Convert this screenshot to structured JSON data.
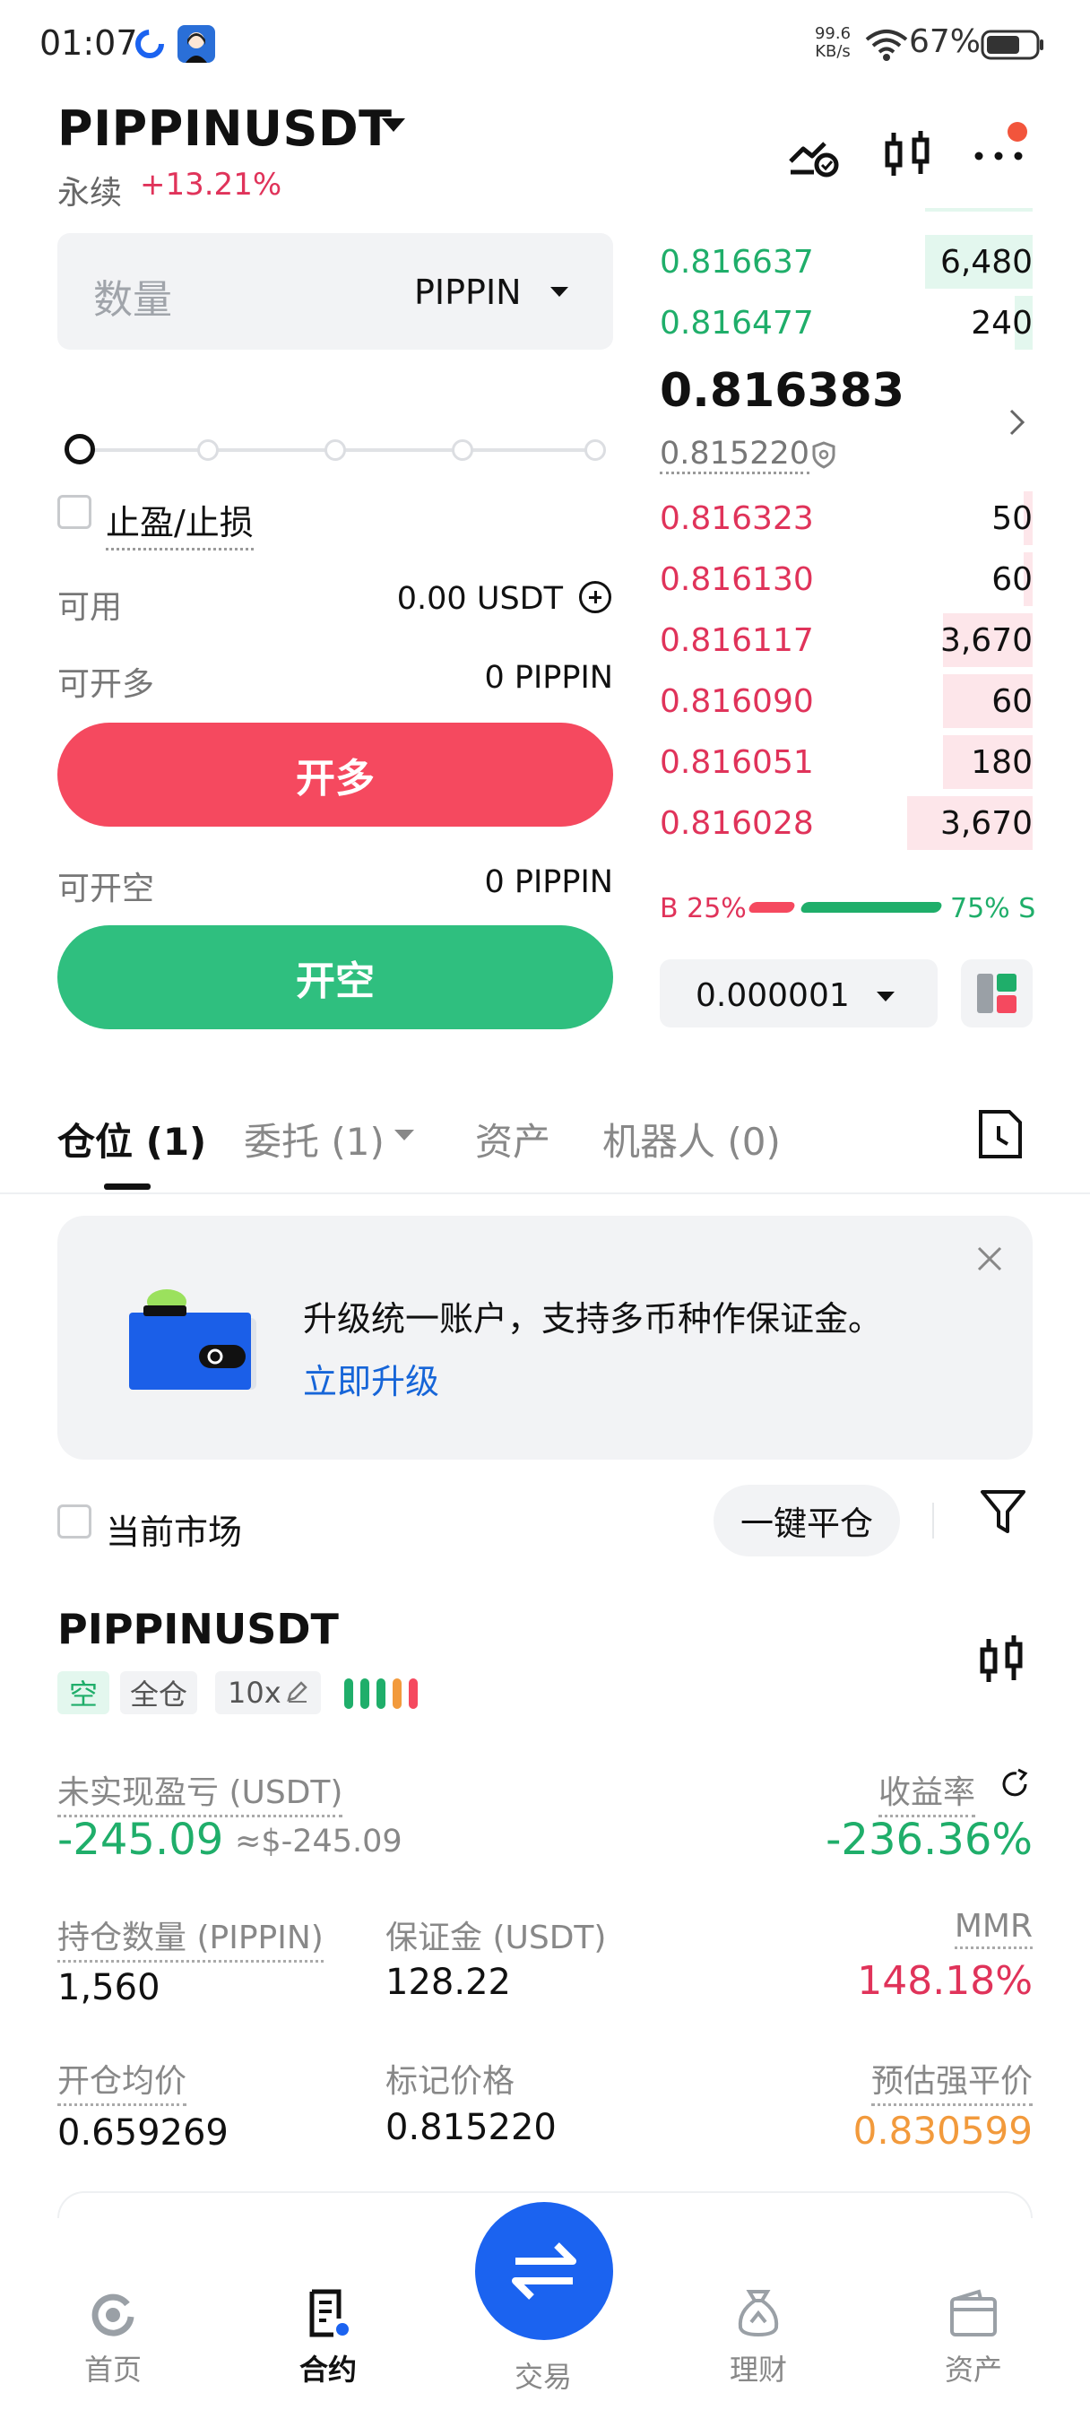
{
  "status_bar": {
    "time": "01:07",
    "net_speed_value": "99.6",
    "net_speed_unit": "KB/s",
    "battery": "67%"
  },
  "header": {
    "pair": "PIPPINUSDT",
    "contract_type": "永续",
    "change_pct": "+13.21%",
    "icons": [
      "trend-check-icon",
      "candlestick-icon",
      "more-icon"
    ]
  },
  "order_form": {
    "qty_placeholder": "数量",
    "qty_unit": "PIPPIN",
    "tpsl_label": "止盈/止损",
    "available_label": "可用",
    "available_value": "0.00 USDT",
    "can_long_label": "可开多",
    "can_long_value": "0 PIPPIN",
    "long_button": "开多",
    "can_short_label": "可开空",
    "can_short_value": "0 PIPPIN",
    "short_button": "开空",
    "leverage_slider_pct": 0
  },
  "order_book": {
    "asks": [
      {
        "price": "0.816637",
        "qty": "6,480",
        "depth": 0.17
      },
      {
        "price": "0.816477",
        "qty": "240",
        "depth": 0.03
      }
    ],
    "last_price": "0.816383",
    "mark_price": "0.815220",
    "bids": [
      {
        "price": "0.816323",
        "qty": "50",
        "depth": 0.01
      },
      {
        "price": "0.816130",
        "qty": "60",
        "depth": 0.01
      },
      {
        "price": "0.816117",
        "qty": "3,670",
        "depth": 0.14
      },
      {
        "price": "0.816090",
        "qty": "60",
        "depth": 0.01
      },
      {
        "price": "0.816051",
        "qty": "180",
        "depth": 0.01
      },
      {
        "price": "0.816028",
        "qty": "3,670",
        "depth": 0.19
      }
    ],
    "buy_ratio": "B 25%",
    "sell_ratio": "75% S",
    "buy_ratio_value": 25,
    "sell_ratio_value": 75,
    "tick_size": "0.000001"
  },
  "tabs": {
    "positions": "仓位 (1)",
    "orders": "委托 (1)",
    "assets": "资产",
    "bots": "机器人 (0)"
  },
  "banner": {
    "text": "升级统一账户，支持多币种作保证金。",
    "link": "立即升级"
  },
  "filter": {
    "current_market": "当前市场",
    "close_all": "一键平仓"
  },
  "position": {
    "symbol": "PIPPINUSDT",
    "side": "空",
    "margin_mode": "全仓",
    "leverage": "10x",
    "risk_level_colors": [
      "#1fae6a",
      "#1fae6a",
      "#1fae6a",
      "#f29a3c",
      "#f5495f"
    ],
    "unrealized_pnl_label": "未实现盈亏 (USDT)",
    "unrealized_pnl": "-245.09",
    "unrealized_pnl_approx": "≈$-245.09",
    "roe_label": "收益率",
    "roe": "-236.36%",
    "size_label": "持仓数量 (PIPPIN)",
    "size": "1,560",
    "margin_label": "保证金 (USDT)",
    "margin": "128.22",
    "mmr_label": "MMR",
    "mmr": "148.18%",
    "entry_label": "开仓均价",
    "entry": "0.659269",
    "mark_label": "标记价格",
    "mark": "0.815220",
    "liq_label": "预估强平价",
    "liq": "0.830599"
  },
  "bottom_nav": {
    "home": "首页",
    "futures": "合约",
    "trade": "交易",
    "earn": "理财",
    "assets": "资产"
  },
  "colors": {
    "long": "#f5495f",
    "short": "#2fbf7f",
    "bid_text": "#e0335a",
    "ask_text": "#1fae6a",
    "accent_blue": "#1b63f0"
  }
}
